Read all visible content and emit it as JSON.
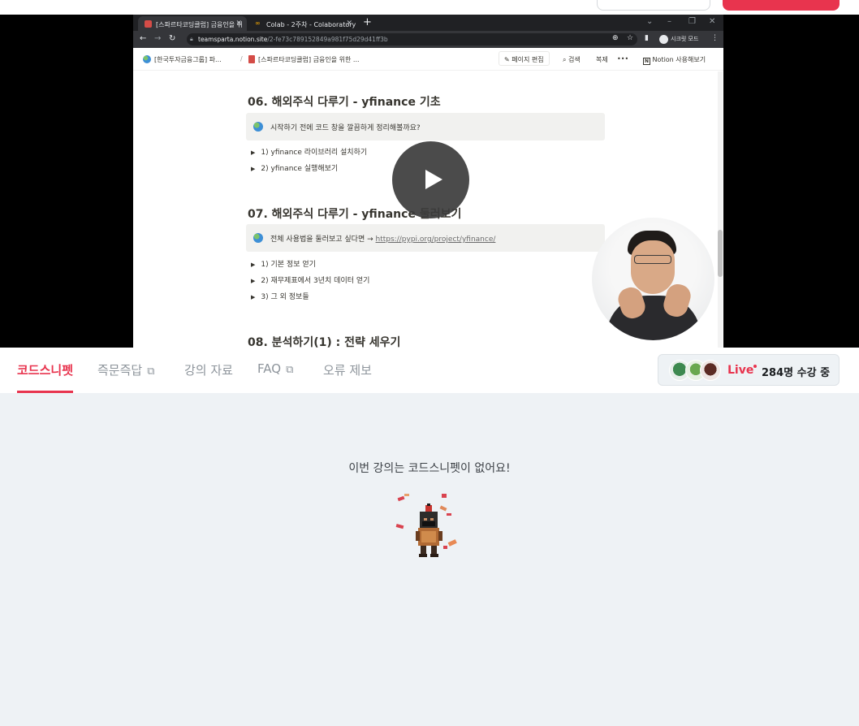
{
  "browser": {
    "tabs": [
      {
        "title": "[스파르타코딩클럽] 금융인을 위",
        "active": true
      },
      {
        "title": "Colab - 2주차 - Colaboratory",
        "active": false
      }
    ],
    "url_host": "teamsparta.notion.site",
    "url_path": "/2-fe73c789152849a981f75d29d41ff3b",
    "incognito_label": "시크릿 모드"
  },
  "notion": {
    "breadcrumb": [
      "[한국투자금융그룹] 파...",
      "[스파르타코딩클럽] 금융인을 위한 ..."
    ],
    "edit_label": "페이지 편집",
    "search_label": "검색",
    "duplicate_label": "복제",
    "more_label": "•••",
    "try_label": "Notion 사용해보기",
    "sections": [
      {
        "title": "06. 해외주식 다루기 - yfinance 기초",
        "callout": "시작하기 전에 코드 창을 깔끔하게 정리해볼까요?",
        "toggles": [
          "1) yfinance 라이브러리 설치하기",
          "2) yfinance 실행해보기"
        ]
      },
      {
        "title": "07. 해외주식 다루기 - yfinance 둘러보기",
        "callout": "전체 사용법을 둘러보고 싶다면 →",
        "callout_link": "https://pypi.org/project/yfinance/",
        "toggles": [
          "1) 기본 정보 얻기",
          "2) 재무제표에서 3년치 데이터 얻기",
          "3) 그 외 정보들"
        ]
      },
      {
        "title": "08. 분석하기(1) : 전략 세우기"
      }
    ]
  },
  "tabs": {
    "items": [
      {
        "label": "코드스니펫",
        "active": true,
        "external": false
      },
      {
        "label": "즉문즉답",
        "active": false,
        "external": true
      },
      {
        "label": "강의 자료",
        "active": false,
        "external": false
      },
      {
        "label": "FAQ",
        "active": false,
        "external": true
      },
      {
        "label": "오류 제보",
        "active": false,
        "external": false
      }
    ]
  },
  "live": {
    "label": "Live",
    "count_text": "284명 수강 중"
  },
  "empty_state": {
    "message": "이번 강의는 코드스니펫이 없어요!"
  },
  "colors": {
    "accent": "#e8344e",
    "background": "#eef2f5",
    "tab_inactive": "#8d949b"
  }
}
